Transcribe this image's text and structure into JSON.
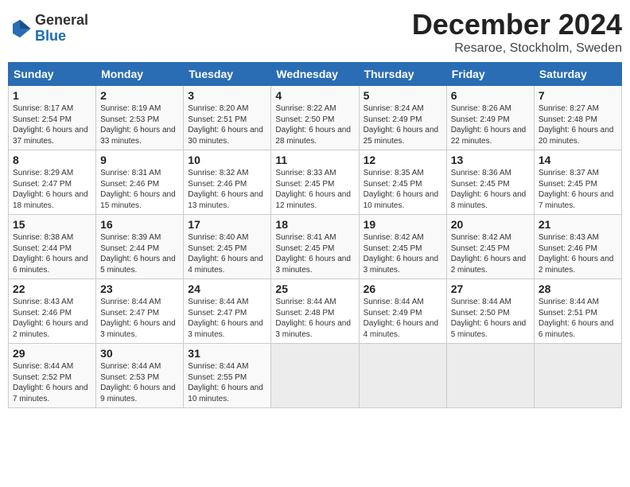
{
  "logo": {
    "general": "General",
    "blue": "Blue"
  },
  "title": "December 2024",
  "subtitle": "Resaroe, Stockholm, Sweden",
  "headers": [
    "Sunday",
    "Monday",
    "Tuesday",
    "Wednesday",
    "Thursday",
    "Friday",
    "Saturday"
  ],
  "weeks": [
    [
      {
        "day": "1",
        "sunrise": "8:17 AM",
        "sunset": "2:54 PM",
        "daylight": "6 hours and 37 minutes."
      },
      {
        "day": "2",
        "sunrise": "8:19 AM",
        "sunset": "2:53 PM",
        "daylight": "6 hours and 33 minutes."
      },
      {
        "day": "3",
        "sunrise": "8:20 AM",
        "sunset": "2:51 PM",
        "daylight": "6 hours and 30 minutes."
      },
      {
        "day": "4",
        "sunrise": "8:22 AM",
        "sunset": "2:50 PM",
        "daylight": "6 hours and 28 minutes."
      },
      {
        "day": "5",
        "sunrise": "8:24 AM",
        "sunset": "2:49 PM",
        "daylight": "6 hours and 25 minutes."
      },
      {
        "day": "6",
        "sunrise": "8:26 AM",
        "sunset": "2:49 PM",
        "daylight": "6 hours and 22 minutes."
      },
      {
        "day": "7",
        "sunrise": "8:27 AM",
        "sunset": "2:48 PM",
        "daylight": "6 hours and 20 minutes."
      }
    ],
    [
      {
        "day": "8",
        "sunrise": "8:29 AM",
        "sunset": "2:47 PM",
        "daylight": "6 hours and 18 minutes."
      },
      {
        "day": "9",
        "sunrise": "8:31 AM",
        "sunset": "2:46 PM",
        "daylight": "6 hours and 15 minutes."
      },
      {
        "day": "10",
        "sunrise": "8:32 AM",
        "sunset": "2:46 PM",
        "daylight": "6 hours and 13 minutes."
      },
      {
        "day": "11",
        "sunrise": "8:33 AM",
        "sunset": "2:45 PM",
        "daylight": "6 hours and 12 minutes."
      },
      {
        "day": "12",
        "sunrise": "8:35 AM",
        "sunset": "2:45 PM",
        "daylight": "6 hours and 10 minutes."
      },
      {
        "day": "13",
        "sunrise": "8:36 AM",
        "sunset": "2:45 PM",
        "daylight": "6 hours and 8 minutes."
      },
      {
        "day": "14",
        "sunrise": "8:37 AM",
        "sunset": "2:45 PM",
        "daylight": "6 hours and 7 minutes."
      }
    ],
    [
      {
        "day": "15",
        "sunrise": "8:38 AM",
        "sunset": "2:44 PM",
        "daylight": "6 hours and 6 minutes."
      },
      {
        "day": "16",
        "sunrise": "8:39 AM",
        "sunset": "2:44 PM",
        "daylight": "6 hours and 5 minutes."
      },
      {
        "day": "17",
        "sunrise": "8:40 AM",
        "sunset": "2:45 PM",
        "daylight": "6 hours and 4 minutes."
      },
      {
        "day": "18",
        "sunrise": "8:41 AM",
        "sunset": "2:45 PM",
        "daylight": "6 hours and 3 minutes."
      },
      {
        "day": "19",
        "sunrise": "8:42 AM",
        "sunset": "2:45 PM",
        "daylight": "6 hours and 3 minutes."
      },
      {
        "day": "20",
        "sunrise": "8:42 AM",
        "sunset": "2:45 PM",
        "daylight": "6 hours and 2 minutes."
      },
      {
        "day": "21",
        "sunrise": "8:43 AM",
        "sunset": "2:46 PM",
        "daylight": "6 hours and 2 minutes."
      }
    ],
    [
      {
        "day": "22",
        "sunrise": "8:43 AM",
        "sunset": "2:46 PM",
        "daylight": "6 hours and 2 minutes."
      },
      {
        "day": "23",
        "sunrise": "8:44 AM",
        "sunset": "2:47 PM",
        "daylight": "6 hours and 3 minutes."
      },
      {
        "day": "24",
        "sunrise": "8:44 AM",
        "sunset": "2:47 PM",
        "daylight": "6 hours and 3 minutes."
      },
      {
        "day": "25",
        "sunrise": "8:44 AM",
        "sunset": "2:48 PM",
        "daylight": "6 hours and 3 minutes."
      },
      {
        "day": "26",
        "sunrise": "8:44 AM",
        "sunset": "2:49 PM",
        "daylight": "6 hours and 4 minutes."
      },
      {
        "day": "27",
        "sunrise": "8:44 AM",
        "sunset": "2:50 PM",
        "daylight": "6 hours and 5 minutes."
      },
      {
        "day": "28",
        "sunrise": "8:44 AM",
        "sunset": "2:51 PM",
        "daylight": "6 hours and 6 minutes."
      }
    ],
    [
      {
        "day": "29",
        "sunrise": "8:44 AM",
        "sunset": "2:52 PM",
        "daylight": "6 hours and 7 minutes."
      },
      {
        "day": "30",
        "sunrise": "8:44 AM",
        "sunset": "2:53 PM",
        "daylight": "6 hours and 9 minutes."
      },
      {
        "day": "31",
        "sunrise": "8:44 AM",
        "sunset": "2:55 PM",
        "daylight": "6 hours and 10 minutes."
      },
      null,
      null,
      null,
      null
    ]
  ]
}
